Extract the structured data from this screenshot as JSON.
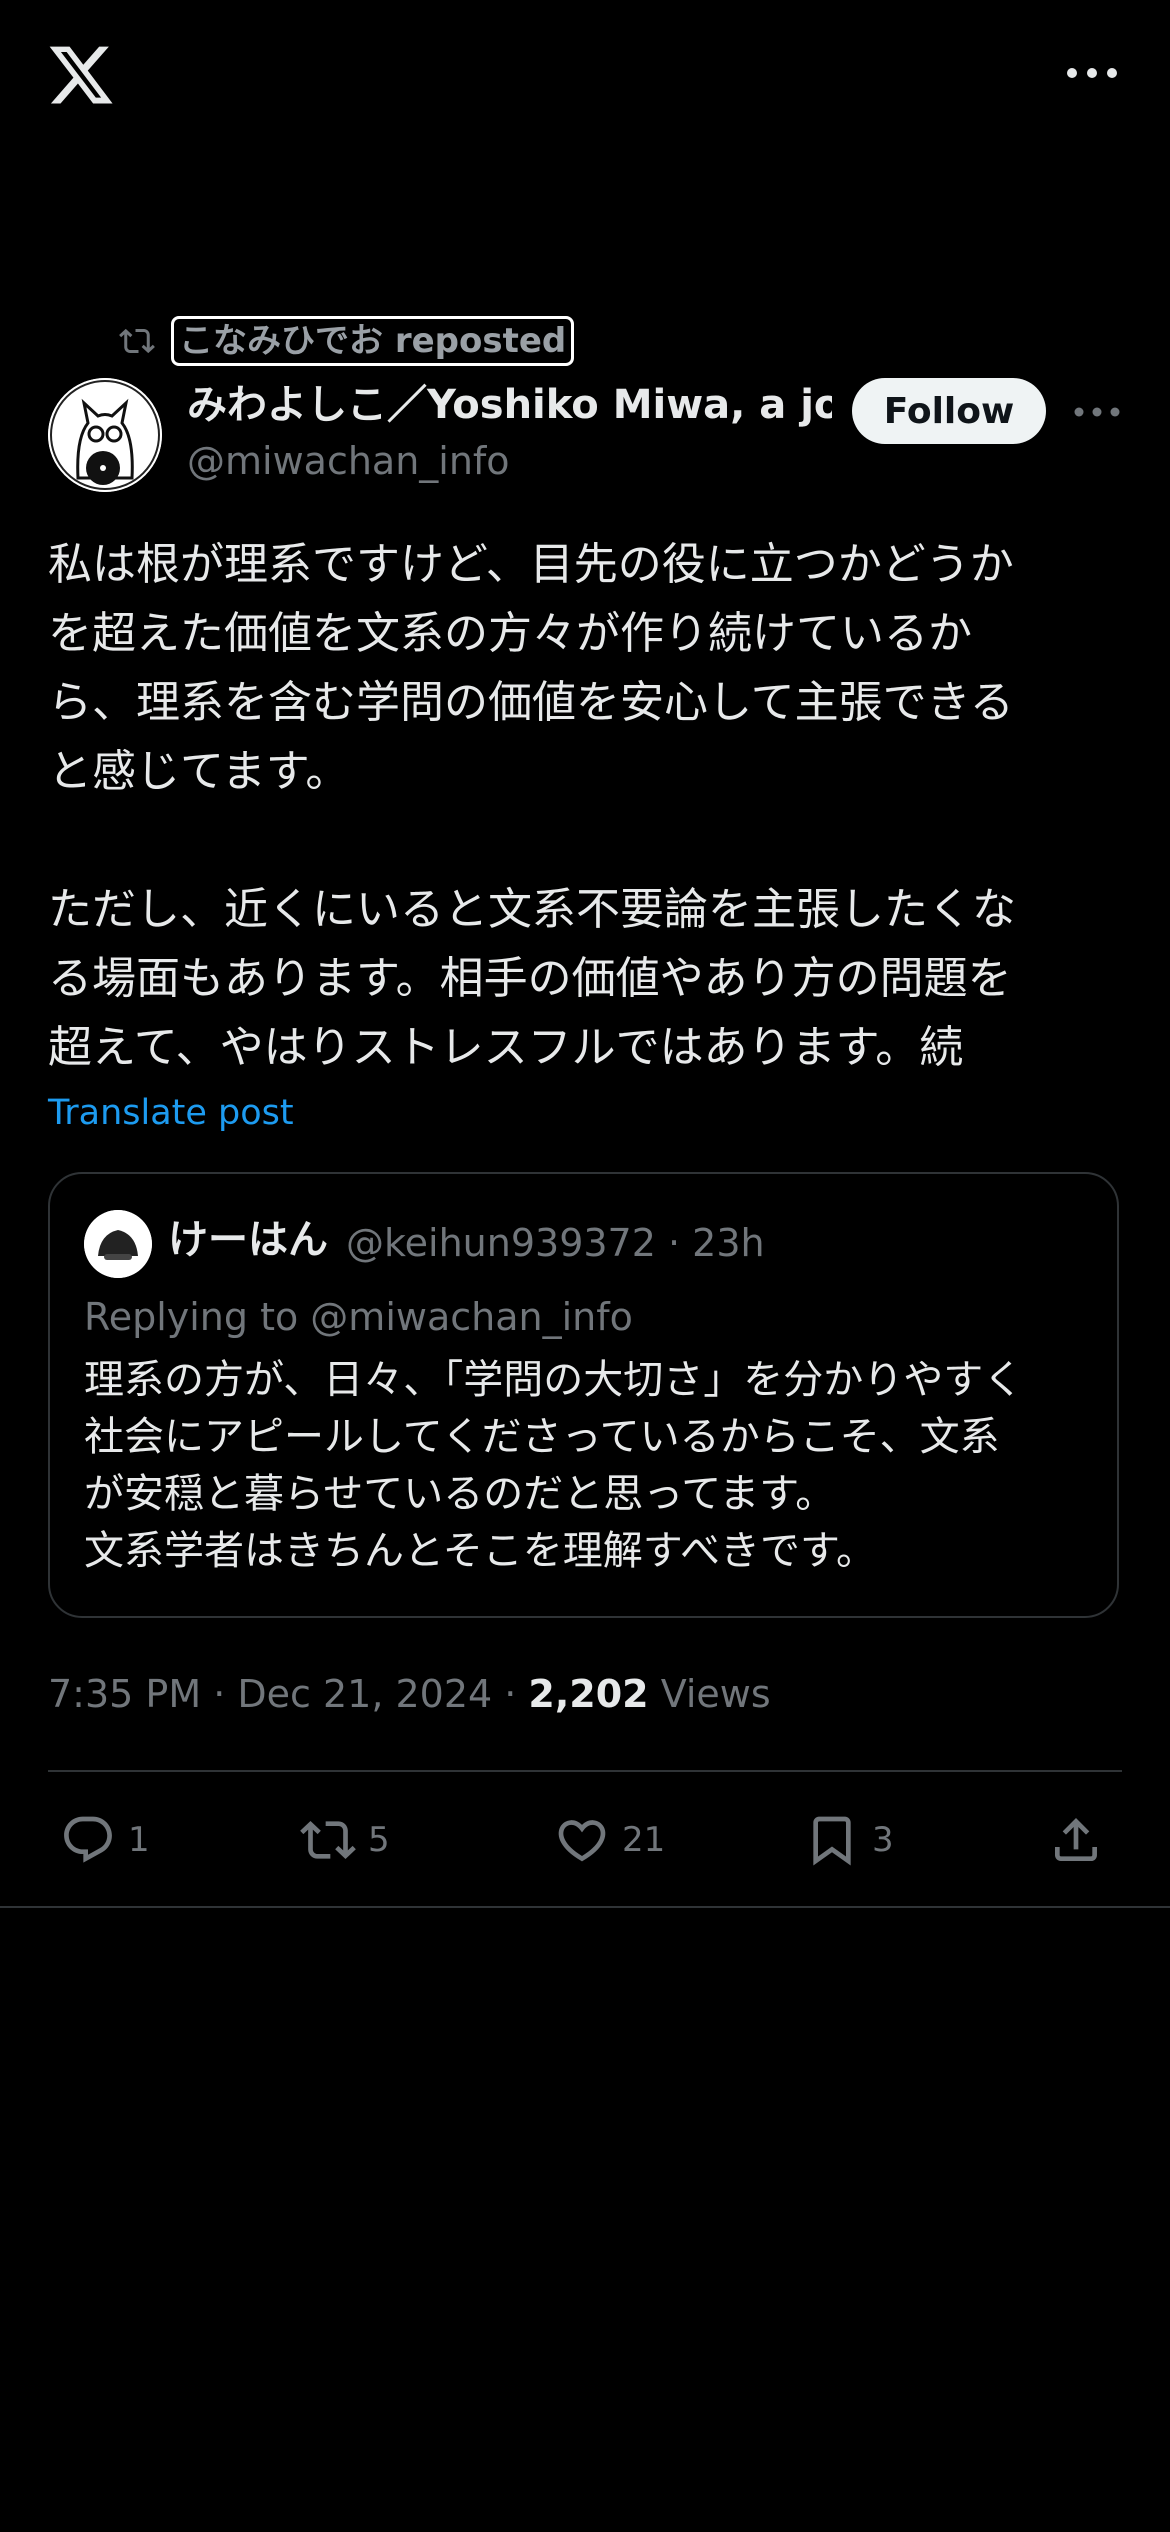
{
  "repost": {
    "label": "こなみひでお reposted"
  },
  "author": {
    "display_name": "みわよしこ／Yoshiko Miwa, a jou",
    "handle": "@miwachan_info"
  },
  "follow_label": "Follow",
  "post": {
    "text": "私は根が理系ですけど、目先の役に立つかどうか\nを超えた価値を文系の方々が作り続けているか\nら、理系を含む学問の価値を安心して主張できる\nと感じてます。\n\nただし、近くにいると文系不要論を主張したくな\nる場面もあります。相手の価値やあり方の問題を\n超えて、やはりストレスフルではあります。続",
    "translate_label": "Translate post"
  },
  "quote": {
    "name": "けーはん",
    "meta": "@keihun939372 · 23h",
    "replying_to": "Replying to @miwachan_info",
    "text": "理系の方が、日々、「学問の大切さ」を分かりやすく\n社会にアピールしてくださっているからこそ、文系\nが安穏と暮らせているのだと思ってます。\n文系学者はきちんとそこを理解すべきです。"
  },
  "meta": {
    "time_date": "7:35 PM · Dec 21, 2024 · ",
    "views_count": "2,202",
    "views_label": " Views"
  },
  "actions": {
    "replies": "1",
    "reposts": "5",
    "likes": "21",
    "bookmarks": "3"
  },
  "icons": [
    "x-logo",
    "more-icon",
    "repost-icon",
    "reply-icon",
    "like-icon",
    "bookmark-icon",
    "share-icon"
  ],
  "colors": {
    "background": "#000000",
    "text": "#e7e9ea",
    "muted": "#71767b",
    "link": "#1d9bf0"
  }
}
